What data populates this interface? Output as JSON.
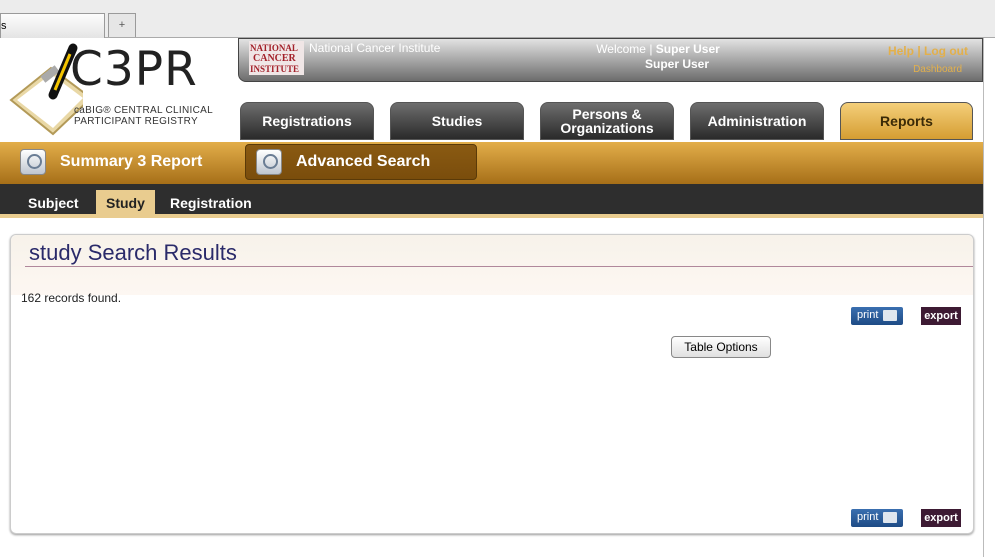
{
  "browser": {
    "tab_label": "s",
    "new_tab_label": "+"
  },
  "header": {
    "logo": {
      "title": "C3PR",
      "subtitle_line1": "caBIG® CENTRAL CLINICAL",
      "subtitle_line2": "PARTICIPANT REGISTRY"
    },
    "nci_logo": "NATIONAL CANCER INSTITUTE",
    "nci_text": "National Cancer Institute",
    "welcome_prefix": "Welcome | ",
    "user_name": "Super User",
    "user_line2": "Super User",
    "help": "Help",
    "separator": " | ",
    "logout": "Log out",
    "dashboard": "Dashboard"
  },
  "nav": {
    "tabs": [
      {
        "label": "Registrations"
      },
      {
        "label": "Studies"
      },
      {
        "label": "Persons & Organizations"
      },
      {
        "label": "Administration"
      },
      {
        "label": "Reports",
        "active": true
      }
    ]
  },
  "subnav": {
    "summary_report": "Summary 3 Report",
    "advanced_search": "Advanced Search"
  },
  "search_tabs": [
    {
      "label": "Subject"
    },
    {
      "label": "Study",
      "active": true
    },
    {
      "label": "Registration"
    }
  ],
  "main": {
    "title": "study Search Results",
    "records_found": "162 records found.",
    "print_label": "print",
    "export_label": "export",
    "table_options_label": "Table Options"
  },
  "colors": {
    "accent": "#d59d32",
    "nav_dark": "#2e2e2e",
    "title_text": "#2a2a6a",
    "export_bg": "#3d1a33"
  }
}
